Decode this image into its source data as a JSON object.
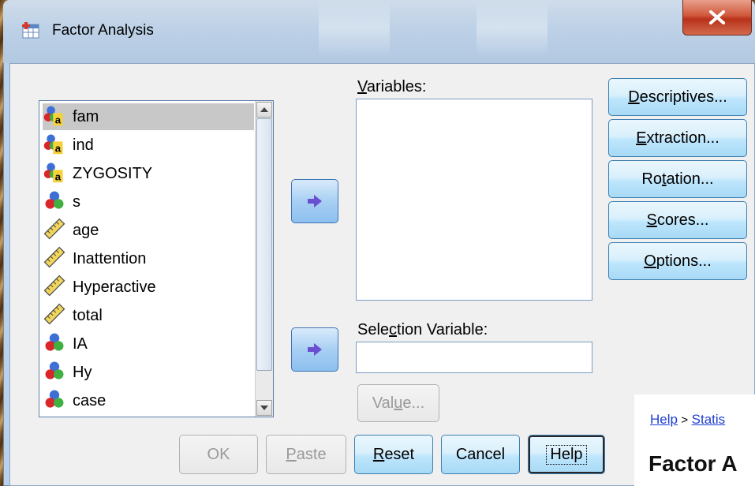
{
  "window": {
    "title": "Factor Analysis",
    "close_label": "X"
  },
  "source_list": {
    "items": [
      {
        "label": "fam",
        "icon": "nominal-string-icon",
        "selected": true
      },
      {
        "label": "ind",
        "icon": "nominal-string-icon",
        "selected": false
      },
      {
        "label": "ZYGOSITY",
        "icon": "nominal-string-icon",
        "selected": false
      },
      {
        "label": "s",
        "icon": "nominal-icon",
        "selected": false
      },
      {
        "label": "age",
        "icon": "scale-ruler-icon",
        "selected": false
      },
      {
        "label": "Inattention",
        "icon": "scale-ruler-icon",
        "selected": false
      },
      {
        "label": "Hyperactive",
        "icon": "scale-ruler-icon",
        "selected": false
      },
      {
        "label": "total",
        "icon": "scale-ruler-icon",
        "selected": false
      },
      {
        "label": "IA",
        "icon": "nominal-icon",
        "selected": false
      },
      {
        "label": "Hy",
        "icon": "nominal-icon",
        "selected": false
      },
      {
        "label": "case",
        "icon": "nominal-icon",
        "selected": false
      }
    ]
  },
  "variables": {
    "label": "Variables:",
    "mnemonic": "V",
    "rest": "ariables:"
  },
  "selection_variable": {
    "label_pre": "Sele",
    "mnemonic": "c",
    "label_post": "tion Variable:",
    "value": ""
  },
  "value_button": {
    "label_pre": "Val",
    "mnemonic": "u",
    "label_post": "e..."
  },
  "side_buttons": [
    {
      "pre": "",
      "mn": "D",
      "post": "escriptives..."
    },
    {
      "pre": "",
      "mn": "E",
      "post": "xtraction..."
    },
    {
      "pre": "Ro",
      "mn": "t",
      "post": "ation..."
    },
    {
      "pre": "",
      "mn": "S",
      "post": "cores..."
    },
    {
      "pre": "",
      "mn": "O",
      "post": "ptions..."
    }
  ],
  "bottom_buttons": {
    "ok": "OK",
    "paste": {
      "mn": "P",
      "post": "aste"
    },
    "reset": {
      "mn": "R",
      "post": "eset"
    },
    "cancel": "Cancel",
    "help": "Help"
  },
  "help_pane": {
    "link1": "Help",
    "sep": ">",
    "link2": "Statis",
    "title": "Factor A"
  },
  "colors": {
    "button_border": "#3c7fb1",
    "list_selected": "#c8c8c8",
    "link": "#1f3fd0"
  }
}
